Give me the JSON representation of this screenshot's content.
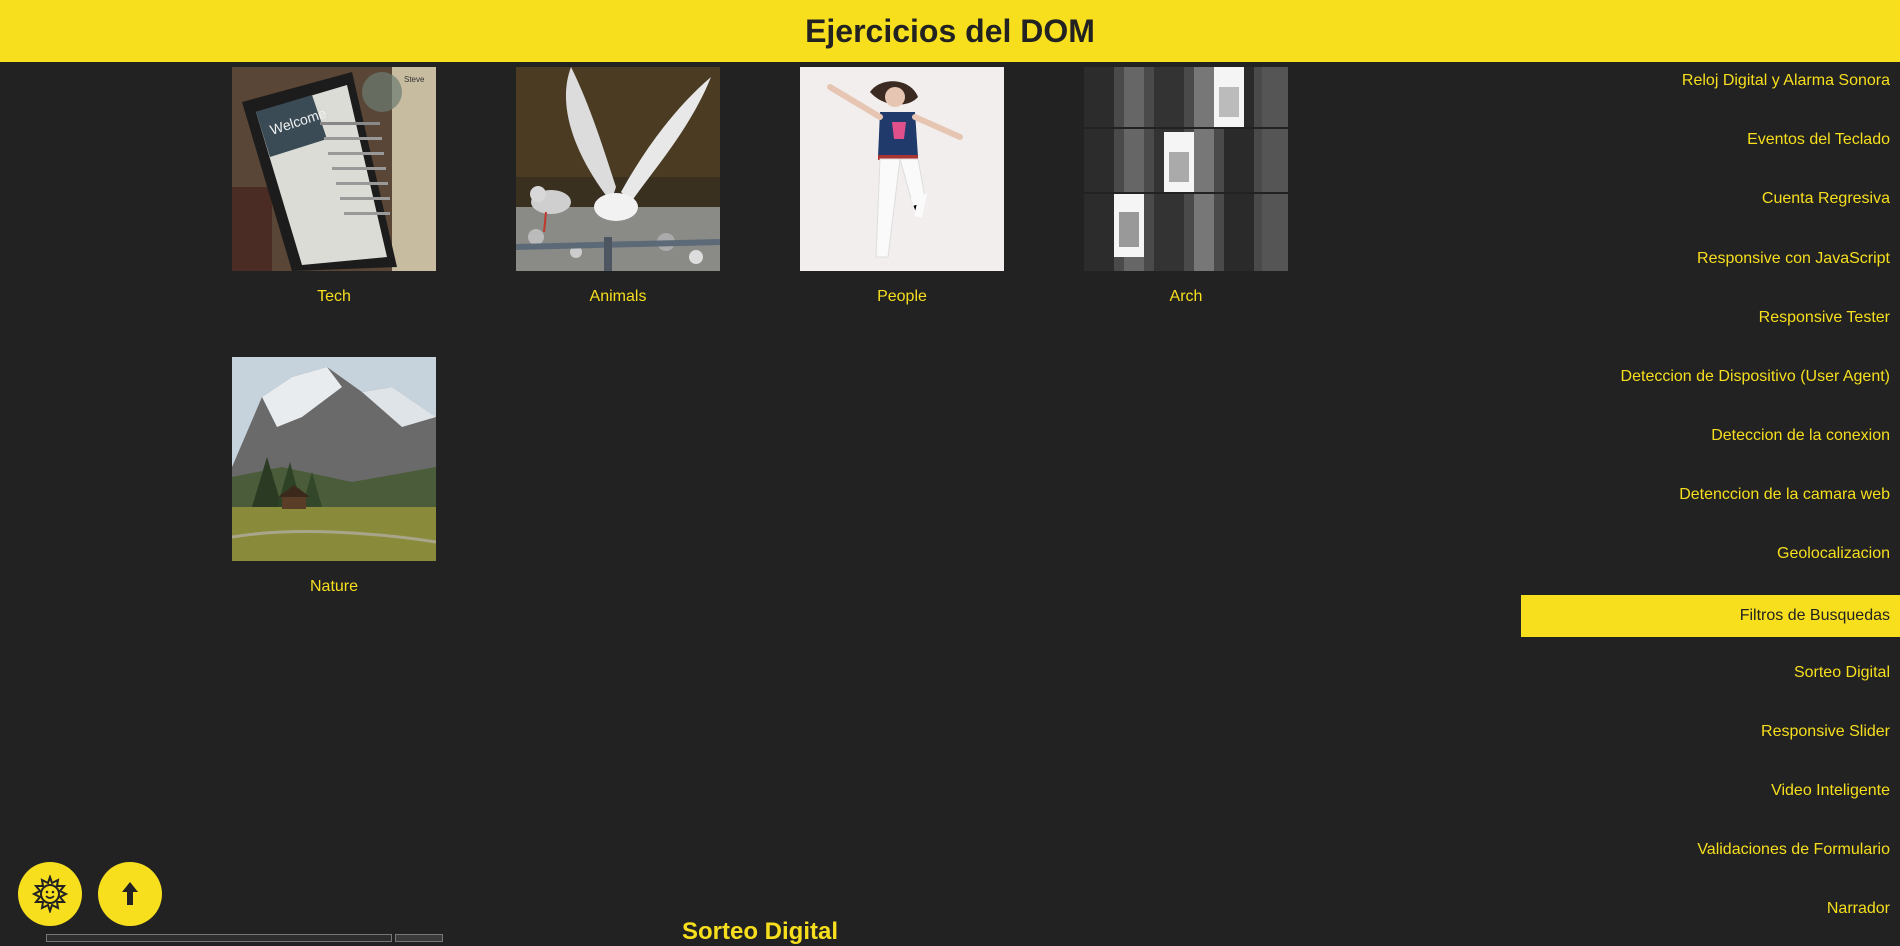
{
  "header": {
    "title": "Ejercicios del DOM"
  },
  "gallery": [
    {
      "caption": "Tech"
    },
    {
      "caption": "Animals"
    },
    {
      "caption": "People"
    },
    {
      "caption": "Arch"
    },
    {
      "caption": "Nature"
    }
  ],
  "nav": {
    "items": [
      "Reloj Digital y Alarma Sonora",
      "Eventos del Teclado",
      "Cuenta Regresiva",
      "Responsive con JavaScript",
      "Responsive Tester",
      "Deteccion de Dispositivo (User Agent)",
      "Deteccion de la conexion",
      "Detenccion de la camara web",
      "Geolocalizacion",
      "Filtros de Busquedas",
      "Sorteo Digital",
      "Responsive Slider",
      "Video Inteligente",
      "Validaciones de Formulario",
      "Narrador"
    ],
    "active": "Filtros de Busquedas"
  },
  "buttons": {
    "theme_icon": "sun-face-icon",
    "scroll_top_icon": "arrow-up-icon"
  },
  "next_section": {
    "title": "Sorteo Digital"
  },
  "colors": {
    "accent": "#f7df1e",
    "background": "#222222"
  }
}
